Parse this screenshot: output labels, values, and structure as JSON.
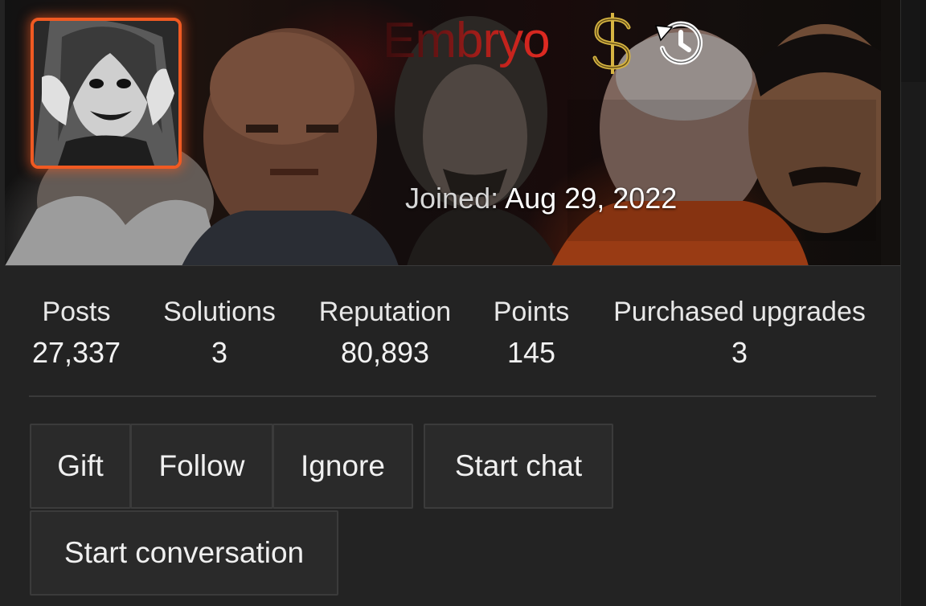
{
  "profile": {
    "username": "Embryo",
    "joined_label": "Joined:",
    "joined_date": "Aug 29, 2022",
    "avatar_icon": "avatar-image",
    "badges": [
      {
        "icon": "dollar-sign-icon",
        "color": "#d6b442"
      },
      {
        "icon": "history-icon",
        "color": "#ffffff"
      }
    ],
    "accent_color": "#f05a22",
    "username_color": "#c0221c"
  },
  "stats": [
    {
      "label": "Posts",
      "value": "27,337"
    },
    {
      "label": "Solutions",
      "value": "3"
    },
    {
      "label": "Reputation",
      "value": "80,893"
    },
    {
      "label": "Points",
      "value": "145"
    },
    {
      "label": "Purchased upgrades",
      "value": "3"
    }
  ],
  "actions": {
    "gift": "Gift",
    "follow": "Follow",
    "ignore": "Ignore",
    "start_chat": "Start chat",
    "start_conversation": "Start conversation"
  }
}
